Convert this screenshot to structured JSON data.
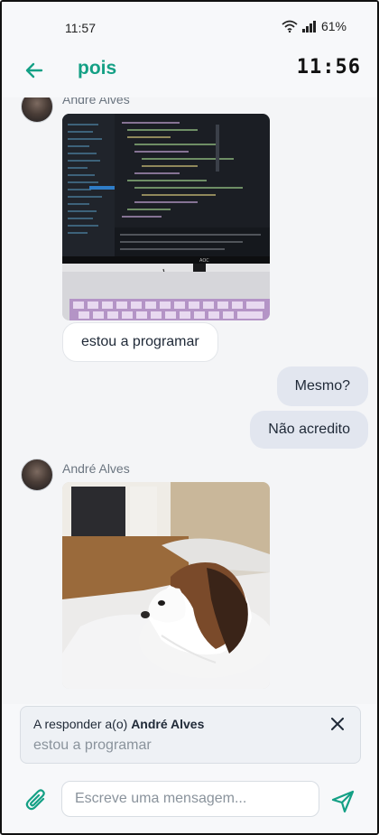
{
  "status_bar": {
    "time": "11:57",
    "battery": "61%",
    "icons": [
      "wifi-icon",
      "signal-icon"
    ]
  },
  "header": {
    "title": "pois",
    "clock": "11:56",
    "back_icon": "arrow-left-icon"
  },
  "messages": [
    {
      "direction": "incoming",
      "sender": "André Alves",
      "image": "photo of a monitor showing code and a lit keyboard",
      "text": "estou a programar"
    },
    {
      "direction": "outgoing",
      "text": "Mesmo?"
    },
    {
      "direction": "outgoing",
      "text": "Não acredito"
    },
    {
      "direction": "incoming",
      "sender": "André Alves",
      "image": "photo of a small white and brown dog lying on a bed"
    }
  ],
  "reply_preview": {
    "label": "A responder a(o)",
    "name": "André Alves",
    "quoted_text": "estou a programar",
    "close_icon": "close-icon"
  },
  "composer": {
    "placeholder": "Escreve uma mensagem...",
    "value": "",
    "attach_icon": "paperclip-icon",
    "send_icon": "send-icon"
  },
  "colors": {
    "accent": "#14a085",
    "outgoing_bubble": "#e2e6ef",
    "incoming_bubble": "#ffffff",
    "background": "#f4f5f7"
  }
}
